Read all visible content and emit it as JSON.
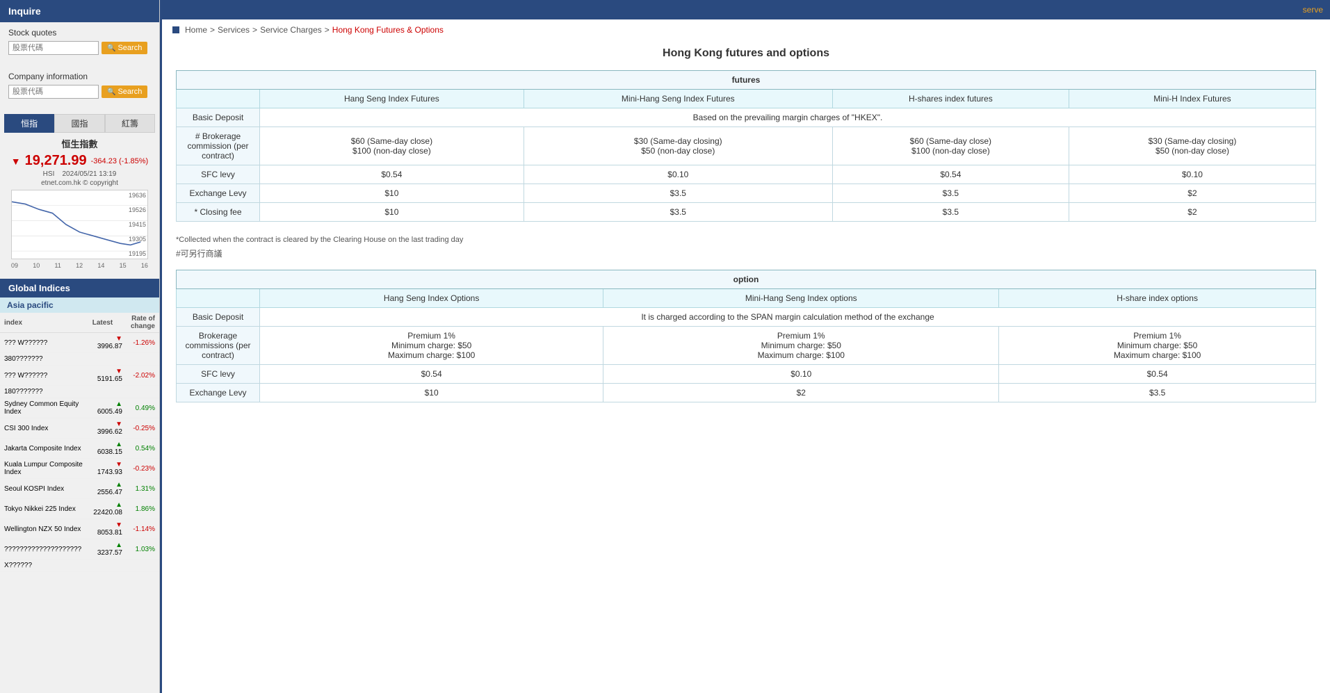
{
  "sidebar": {
    "inquire_label": "Inquire",
    "stock_quotes_label": "Stock quotes",
    "company_info_label": "Company information",
    "search_placeholder": "股票代碼",
    "search_btn_label": "Search",
    "tabs": [
      {
        "label": "恒指",
        "active": true
      },
      {
        "label": "國指",
        "active": false
      },
      {
        "label": "紅籌",
        "active": false
      }
    ],
    "hsi": {
      "title": "恒生指數",
      "value": "19,271.99",
      "change": "-364.23 (-1.85%)",
      "index_name": "HSI",
      "datetime": "2024/05/21 13:19",
      "copyright": "etnet.com.hk © copyright",
      "chart_x_labels": [
        "09",
        "10",
        "11",
        "12",
        "14",
        "15",
        "16"
      ],
      "chart_y_labels": [
        "19636",
        "19526",
        "19415",
        "19305",
        "19195"
      ]
    }
  },
  "global_indices": {
    "header": "Global Indices",
    "asia_pacific": "Asia pacific",
    "col_index": "index",
    "col_latest": "Latest",
    "col_rate": "Rate of change",
    "rows": [
      {
        "name": "??? W??????",
        "latest": "3996.87",
        "change": "-1.26%",
        "direction": "down"
      },
      {
        "name": "380???????",
        "latest": "",
        "change": "",
        "direction": ""
      },
      {
        "name": "??? W??????",
        "latest": "5191.65",
        "change": "-2.02%",
        "direction": "down"
      },
      {
        "name": "180???????",
        "latest": "",
        "change": "",
        "direction": ""
      },
      {
        "name": "Sydney Common Equity Index",
        "latest": "6005.49",
        "change": "0.49%",
        "direction": "up"
      },
      {
        "name": "CSI 300 Index",
        "latest": "3996.62",
        "change": "-0.25%",
        "direction": "down"
      },
      {
        "name": "Jakarta Composite Index",
        "latest": "6038.15",
        "change": "0.54%",
        "direction": "up"
      },
      {
        "name": "Kuala Lumpur Composite Index",
        "latest": "1743.93",
        "change": "-0.23%",
        "direction": "down"
      },
      {
        "name": "Seoul KOSPI Index",
        "latest": "2556.47",
        "change": "1.31%",
        "direction": "up"
      },
      {
        "name": "Tokyo Nikkei 225 Index",
        "latest": "22420.08",
        "change": "1.86%",
        "direction": "up"
      },
      {
        "name": "Wellington NZX 50 Index",
        "latest": "8053.81",
        "change": "-1.14%",
        "direction": "down"
      },
      {
        "name": "????????????????????",
        "latest": "3237.57",
        "change": "1.03%",
        "direction": "up"
      },
      {
        "name": "X??????",
        "latest": "",
        "change": "",
        "direction": ""
      }
    ]
  },
  "topnav": {
    "serve_label": "serve"
  },
  "breadcrumb": {
    "home": "Home",
    "services": "Services",
    "service_charges": "Service Charges",
    "current": "Hong Kong Futures & Options"
  },
  "page": {
    "title": "Hong Kong futures and options",
    "futures_table": {
      "section_label": "futures",
      "col1": "",
      "col2": "Hang Seng Index Futures",
      "col3": "Mini-Hang Seng Index Futures",
      "col4": "H-shares index futures",
      "col5": "Mini-H Index Futures",
      "rows": [
        {
          "label": "Basic Deposit",
          "col2": "Based on the prevailing margin charges of \"HKEX\".",
          "colspan": true
        },
        {
          "label": "# Brokerage commission (per contract)",
          "col2": "$60 (Same-day close)\n$100 (non-day close)",
          "col3": "$30 (Same-day closing)\n$50 (non-day close)",
          "col4": "$60 (Same-day close)\n$100 (non-day close)",
          "col5": "$30 (Same-day closing)\n$50 (non-day close)"
        },
        {
          "label": "SFC levy",
          "col2": "$0.54",
          "col3": "$0.10",
          "col4": "$0.54",
          "col5": "$0.10"
        },
        {
          "label": "Exchange Levy",
          "col2": "$10",
          "col3": "$3.5",
          "col4": "$3.5",
          "col5": "$2"
        },
        {
          "label": "* Closing fee",
          "col2": "$10",
          "col3": "$3.5",
          "col4": "$3.5",
          "col5": "$2"
        }
      ],
      "footnote1": "*Collected when the contract is cleared by the Clearing House on the last trading day",
      "footnote2": "#可另行商議"
    },
    "options_table": {
      "section_label": "option",
      "col1": "",
      "col2": "Hang Seng Index Options",
      "col3": "Mini-Hang Seng Index options",
      "col4": "H-share index options",
      "rows": [
        {
          "label": "Basic Deposit",
          "col2": "It is charged according to the SPAN margin calculation method of the exchange",
          "colspan": true
        },
        {
          "label": "Brokerage commissions (per contract)",
          "col2": "Premium 1%\nMinimum charge: $50\nMaximum charge: $100",
          "col3": "Premium 1%\nMinimum charge: $50\nMaximum charge: $100",
          "col4": "Premium 1%\nMinimum charge: $50\nMaximum charge: $100"
        },
        {
          "label": "SFC levy",
          "col2": "$0.54",
          "col3": "$0.10",
          "col4": "$0.54"
        },
        {
          "label": "Exchange Levy",
          "col2": "$10",
          "col3": "$2",
          "col4": "$3.5"
        }
      ]
    }
  }
}
